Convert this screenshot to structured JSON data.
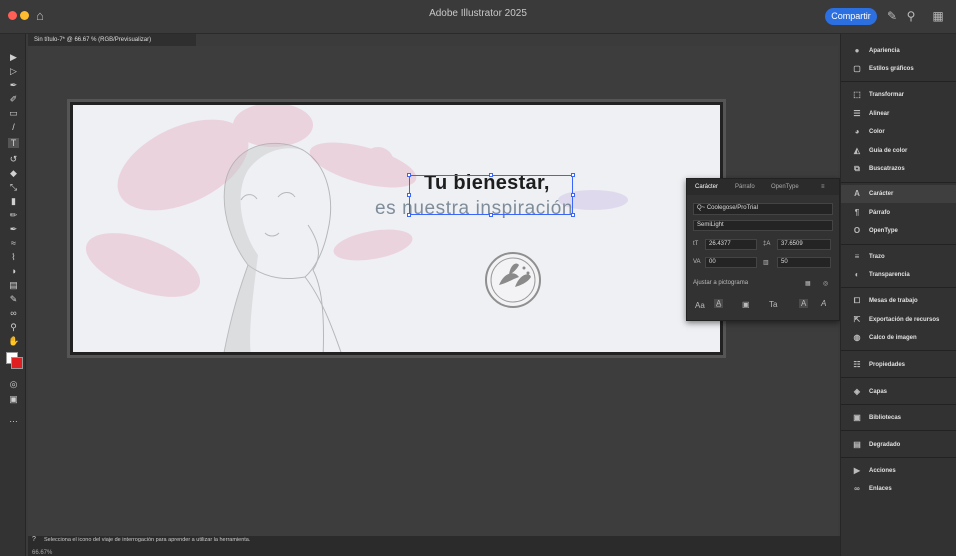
{
  "app": {
    "title": "Adobe Illustrator 2025",
    "share_label": "Compartir"
  },
  "document": {
    "tab_title": "Sin título-7* @ 66.67 % (RGB/Previsualizar)"
  },
  "artboard": {
    "headline": "Tu bienestar,",
    "subline": "es nuestra inspiración",
    "ghost_text": "nuestra inspiración"
  },
  "character_panel": {
    "tabs": [
      "Carácter",
      "Párrafo",
      "OpenType"
    ],
    "search_placeholder": "Q~ Coolegose/ProTrial",
    "font_family": "Coolegose/ProTrial",
    "font_style": "SemiLight",
    "font_size": "26.4377",
    "leading": "37.6509",
    "kerning": "00",
    "tracking": "50",
    "snap_label": "Ajustar a pictograma"
  },
  "right_panel": {
    "items": [
      "Apariencia",
      "Estilos gráficos",
      "Transformar",
      "Alinear",
      "Color",
      "Guía de color",
      "Buscatrazos",
      "Carácter",
      "Párrafo",
      "OpenType",
      "Trazo",
      "Transparencia",
      "Mesas de trabajo",
      "Exportación de recursos",
      "Calco de imagen",
      "Propiedades",
      "Capas",
      "Bibliotecas",
      "Degradado",
      "Acciones",
      "Enlaces"
    ]
  },
  "status": {
    "hint": "Selecciona el icono del viaje de interrogación para aprender a utilizar la herramienta.",
    "zoom": "66.67%"
  },
  "colors": {
    "accent": "#2c6fe0",
    "selection": "#3a66ff",
    "traffic_red": "#ff5f57",
    "traffic_yellow": "#febc2e",
    "traffic_green": "#28c840"
  }
}
